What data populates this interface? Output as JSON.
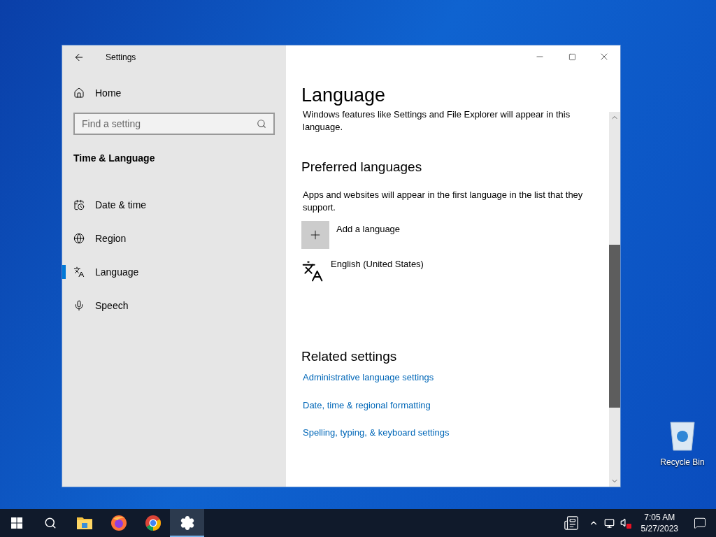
{
  "window": {
    "title": "Settings"
  },
  "sidebar": {
    "home": "Home",
    "search": {
      "placeholder": "Find a setting"
    },
    "section": "Time & Language",
    "items": [
      {
        "label": "Date & time",
        "selected": false
      },
      {
        "label": "Region",
        "selected": false
      },
      {
        "label": "Language",
        "selected": true
      },
      {
        "label": "Speech",
        "selected": false
      }
    ]
  },
  "content": {
    "title": "Language",
    "intro": "Windows features like Settings and File Explorer will appear in this language.",
    "preferred": {
      "heading": "Preferred languages",
      "description": "Apps and websites will appear in the first language in the list that they support.",
      "add": "Add a language",
      "languages": [
        "English (United States)"
      ]
    },
    "related": {
      "heading": "Related settings",
      "links": [
        "Administrative language settings",
        "Date, time & regional formatting",
        "Spelling, typing, & keyboard settings"
      ]
    }
  },
  "desktop": {
    "icons": [
      {
        "label": "Recycle Bin"
      }
    ]
  },
  "taskbar": {
    "apps": [
      {
        "kind": "folder",
        "selected": false
      },
      {
        "kind": "firefox",
        "selected": false
      },
      {
        "kind": "chrome",
        "selected": false
      },
      {
        "kind": "settings",
        "selected": true
      }
    ],
    "clock": {
      "time": "7:05 AM",
      "date": "5/27/2023"
    }
  }
}
